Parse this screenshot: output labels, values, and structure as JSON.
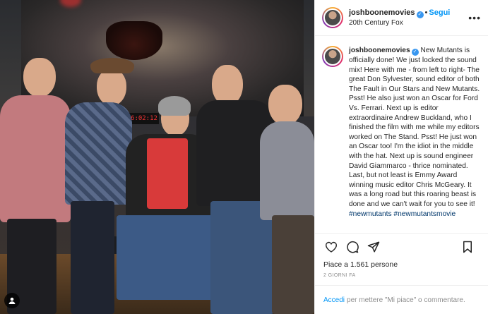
{
  "header": {
    "username": "joshboonemovies",
    "follow_label": "Segui",
    "location": "20th Century Fox",
    "more_label": "•••"
  },
  "photo": {
    "counter_text": "6:02:12"
  },
  "caption": {
    "username": "joshboonemovies",
    "text": "New Mutants is officially done! We just locked the sound mix! Here with me - from left to right- The great Don Sylvester, sound editor of both The Fault in Our Stars and New Mutants. Psst! He also just won an Oscar for Ford Vs. Ferrari. Next up is editor extraordinaire Andrew Buckland, who I finished the film with me while my editors worked on The Stand. Psst! He just won an Oscar too! I'm the idiot in the middle with the hat. Next up is sound engineer David Giammarco - thrice nominated. Last, but not least is Emmy Award winning music editor Chris McGeary. It was a long road but this roaring beast is done and we can't wait for you to see it!",
    "hashtags": "#newmutants #newmutantsmovie"
  },
  "actions": {
    "icons": [
      "heart-icon",
      "comment-icon",
      "share-icon",
      "bookmark-icon"
    ]
  },
  "likes_text": "Piace a 1.561 persone",
  "time_text": "2 GIORNI FA",
  "footer": {
    "login_link": "Accedi",
    "login_rest": "per mettere \"Mi piace\" o commentare."
  },
  "colors": {
    "accent": "#0095f6",
    "verified": "#3897f0",
    "text": "#262626",
    "muted": "#8e8e8e"
  }
}
